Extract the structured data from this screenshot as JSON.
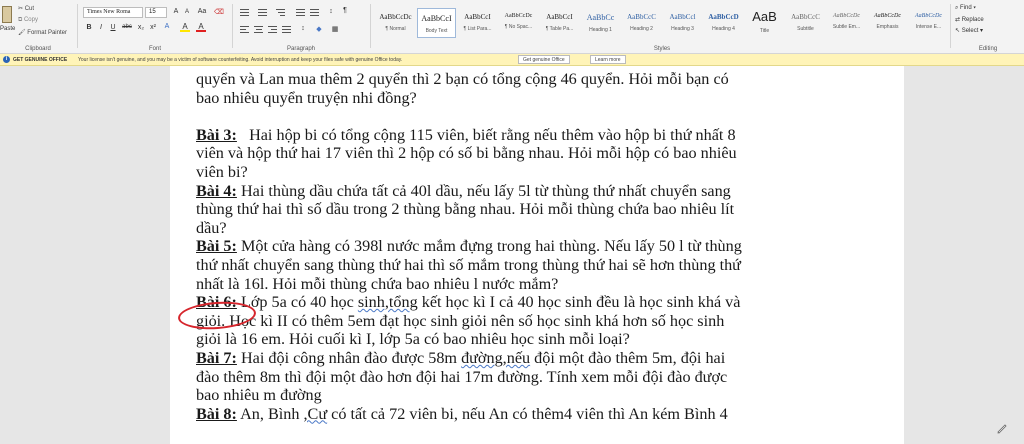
{
  "ribbon": {
    "clipboard": {
      "cut": "Cut",
      "copy": "Copy",
      "paste": "Paste",
      "format_painter": "Format Painter",
      "label": "Clipboard"
    },
    "font": {
      "font_name": "Times New Roma",
      "font_size": "15",
      "grow": "A",
      "shrink": "A",
      "change_case": "Aa",
      "bold": "B",
      "italic": "I",
      "underline": "U",
      "strikethrough": "abc",
      "subscript": "x₂",
      "superscript": "x²",
      "highlight": "A",
      "font_color": "A",
      "label": "Font"
    },
    "paragraph": {
      "label": "Paragraph",
      "pilcrow": "¶"
    },
    "styles": {
      "label": "Styles",
      "items": [
        {
          "sample": "AaBbCcDc",
          "name": "¶ Normal"
        },
        {
          "sample": "AaBbCcI",
          "name": "Body Text"
        },
        {
          "sample": "AaBbCcI",
          "name": "¶ List Para..."
        },
        {
          "sample": "AaBbCcDc",
          "name": "¶ No Spac..."
        },
        {
          "sample": "AaBbCcI",
          "name": "¶ Table Pa..."
        },
        {
          "sample": "AaBbCc",
          "name": "Heading 1"
        },
        {
          "sample": "AaBbCcC",
          "name": "Heading 2"
        },
        {
          "sample": "AaBbCcl",
          "name": "Heading 3"
        },
        {
          "sample": "AaBbCcD",
          "name": "Heading 4"
        },
        {
          "sample": "AaB",
          "name": "Title"
        },
        {
          "sample": "AaBbCcC",
          "name": "Subtitle"
        },
        {
          "sample": "AaBbCcDc",
          "name": "Subtle Em..."
        },
        {
          "sample": "AaBbCcDc",
          "name": "Emphasis"
        },
        {
          "sample": "AaBbCcDc",
          "name": "Intense E..."
        }
      ]
    },
    "editing": {
      "find": "Find",
      "replace": "Replace",
      "select": "Select",
      "label": "Editing"
    }
  },
  "notification": {
    "title": "GET GENUINE OFFICE",
    "message": "Your license isn't genuine, and you may be a victim of software counterfeiting. Avoid interruption and keep your files safe with genuine Office today.",
    "get_button": "Get genuine Office",
    "learn_button": "Learn more"
  },
  "document": {
    "intro_line1": "quyển và Lan mua thêm 2 quyển thì 2 bạn có tổng cộng 46 quyển. Hỏi mỗi bạn có",
    "intro_line2": "bao nhiêu quyển truyện nhi đồng?",
    "b3_label": "Bài 3:",
    "b3_line1": "   Hai hộp bi có tổng cộng 115 viên, biết rằng nếu thêm vào hộp bi thứ nhất 8",
    "b3_line2": "viên và hộp thứ hai 17 viên thì 2 hộp có số bi bằng nhau. Hỏi mỗi hộp có bao nhiêu",
    "b3_line3": "viên bi?",
    "b4_label": "Bài 4:",
    "b4_line1": " Hai thùng dầu chứa tất cả 40l dầu, nếu lấy 5l từ thùng thứ nhất chuyển sang",
    "b4_line2": "thùng thứ hai thì số dầu trong 2 thùng bằng nhau. Hỏi mỗi thùng chứa bao nhiêu lít",
    "b4_line3": "dầu?",
    "b5_label": "Bài 5:",
    "b5_line1": " Một cửa hàng có 398l nước mắm đựng trong hai thùng. Nếu lấy 50 l từ thùng",
    "b5_line2": "thứ nhất chuyển sang thùng thứ hai thì số mắm trong thùng thứ hai sẽ hơn thùng thứ",
    "b5_line3": "nhất là 16l. Hỏi mỗi thùng chứa bao nhiêu l nước mắm?",
    "b6_label": "Bài 6:",
    "b6_line1_a": " Lớp 5a có 40 học ",
    "b6_line1_sq": "sinh,tổng",
    "b6_line1_b": " kết học kì I cả 40 học sinh đều là học sinh khá và",
    "b6_line2": "giỏi. Học kì II có thêm 5em đạt học sinh giỏi nên số học sinh khá hơn số học sinh",
    "b6_line3": "giỏi là 16 em. Hỏi cuối kì I, lớp 5a có bao nhiêu học sinh mỗi loại?",
    "b7_label": "Bài 7:",
    "b7_line1_a": " Hai đội công nhân đào được 58m ",
    "b7_line1_sq": "đường,nếu",
    "b7_line1_b": " đội một đào thêm 5m, đội hai",
    "b7_line2": "đào thêm 8m thì đội một đào hơn đội hai 17m đường. Tính xem mỗi đội đào được",
    "b7_line3": "bao nhiêu m đường",
    "b8_label": "Bài 8:",
    "b8_line1_a": " An, Bình ",
    "b8_line1_sq": ",Cư",
    "b8_line1_b": " có tất cả 72 viên bi, nếu An có thêm4 viên thì An kém Bình 4"
  },
  "colors": {
    "highlight": "#ffe600",
    "font_color": "#e02020",
    "annotation": "#d6252c",
    "notice_bg": "#fff4b8"
  }
}
